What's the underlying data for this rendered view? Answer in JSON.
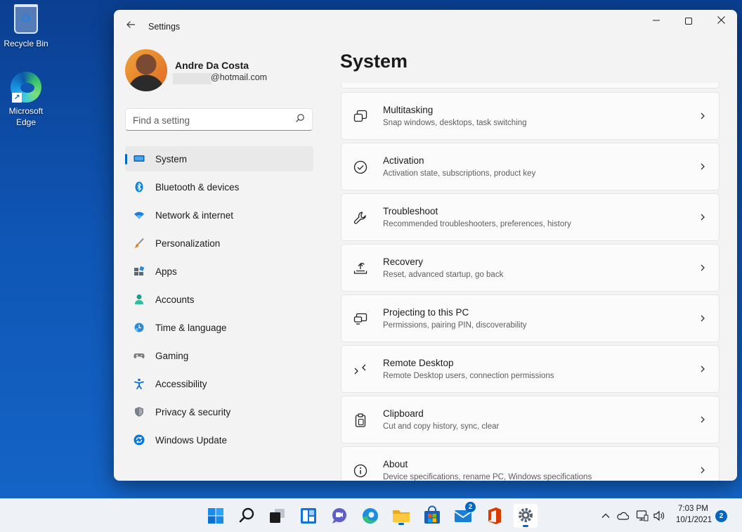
{
  "desktop": {
    "icons": [
      {
        "label": "Recycle Bin",
        "icon": "recycle-bin-icon"
      },
      {
        "label": "Microsoft Edge",
        "icon": "edge-icon"
      }
    ]
  },
  "window": {
    "title": "Settings",
    "controls": {
      "minimize": "minimize",
      "maximize": "maximize",
      "close": "close"
    }
  },
  "profile": {
    "name": "Andre Da Costa",
    "email": "@hotmail.com"
  },
  "search": {
    "placeholder": "Find a setting"
  },
  "nav": {
    "active": "System",
    "items": [
      {
        "label": "System",
        "icon": "system-display-icon",
        "color": "#0067c0"
      },
      {
        "label": "Bluetooth & devices",
        "icon": "bluetooth-icon",
        "color": "#0a84d6"
      },
      {
        "label": "Network & internet",
        "icon": "wifi-icon",
        "color": "#1a7fd4"
      },
      {
        "label": "Personalization",
        "icon": "brush-icon",
        "color": "#e08a2e"
      },
      {
        "label": "Apps",
        "icon": "apps-icon",
        "color": "#5a6878"
      },
      {
        "label": "Accounts",
        "icon": "person-icon",
        "color": "#1f9e8a"
      },
      {
        "label": "Time & language",
        "icon": "globe-clock-icon",
        "color": "#2a8ad8"
      },
      {
        "label": "Gaming",
        "icon": "controller-icon",
        "color": "#7a7a7a"
      },
      {
        "label": "Accessibility",
        "icon": "accessibility-icon",
        "color": "#0a6fd0"
      },
      {
        "label": "Privacy & security",
        "icon": "shield-icon",
        "color": "#7a7f88"
      },
      {
        "label": "Windows Update",
        "icon": "update-icon",
        "color": "#0a78d8"
      }
    ]
  },
  "main": {
    "title": "System",
    "cards": [
      {
        "title": "Multitasking",
        "subtitle": "Snap windows, desktops, task switching",
        "icon": "multitasking-icon"
      },
      {
        "title": "Activation",
        "subtitle": "Activation state, subscriptions, product key",
        "icon": "check-circle-icon"
      },
      {
        "title": "Troubleshoot",
        "subtitle": "Recommended troubleshooters, preferences, history",
        "icon": "wrench-icon"
      },
      {
        "title": "Recovery",
        "subtitle": "Reset, advanced startup, go back",
        "icon": "recovery-icon"
      },
      {
        "title": "Projecting to this PC",
        "subtitle": "Permissions, pairing PIN, discoverability",
        "icon": "projecting-icon"
      },
      {
        "title": "Remote Desktop",
        "subtitle": "Remote Desktop users, connection permissions",
        "icon": "remote-desktop-icon"
      },
      {
        "title": "Clipboard",
        "subtitle": "Cut and copy history, sync, clear",
        "icon": "clipboard-icon"
      },
      {
        "title": "About",
        "subtitle": "Device specifications, rename PC, Windows specifications",
        "icon": "info-icon"
      }
    ]
  },
  "taskbar": {
    "apps": [
      {
        "icon": "start-icon"
      },
      {
        "icon": "search-icon"
      },
      {
        "icon": "task-view-icon"
      },
      {
        "icon": "widgets-icon"
      },
      {
        "icon": "chat-icon"
      },
      {
        "icon": "edge-icon"
      },
      {
        "icon": "file-explorer-icon"
      },
      {
        "icon": "store-icon"
      },
      {
        "icon": "mail-icon",
        "badge": "2"
      },
      {
        "icon": "office-icon"
      },
      {
        "icon": "settings-gear-icon"
      }
    ],
    "tray": {
      "time": "7:03 PM",
      "date": "10/1/2021",
      "notifications": "2"
    }
  },
  "colors": {
    "accent": "#0067c0",
    "desktop": "#0f56b5",
    "window_bg": "#f3f3f3"
  }
}
